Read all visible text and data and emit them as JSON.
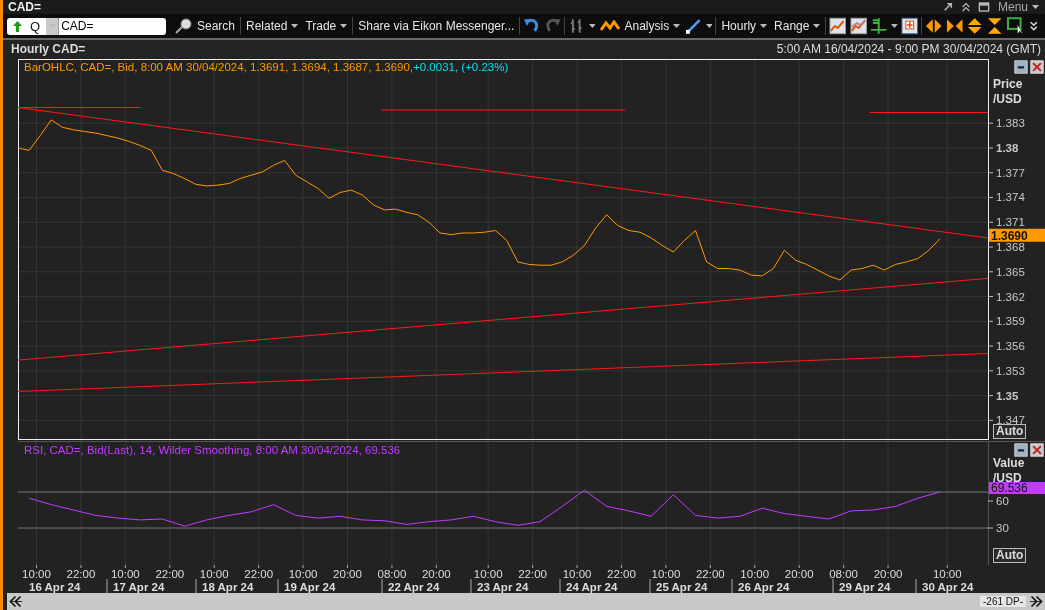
{
  "window": {
    "title": "CAD="
  },
  "title_bar": {
    "menu": "Menu"
  },
  "toolbar": {
    "quote_type": "Q",
    "symbol_field": {
      "value": "CAD="
    },
    "search": "Search",
    "related": "Related",
    "trade": "Trade",
    "share": "Share via Eikon Messenger...",
    "analysis": "Analysis",
    "interval": "Hourly",
    "range": "Range"
  },
  "header": {
    "title": "Hourly CAD=",
    "date_range": "5:00 AM 16/04/2024 - 9:00 PM 30/04/2024 (GMT)"
  },
  "price_panel": {
    "legend": "BarOHLC, CAD=, Bid, 8:00 AM 30/04/2024, 1.3691, 1.3694, 1.3687, 1.3690, ",
    "change": "+0.0031, (+0.23%)",
    "axis_title": "Price /USD",
    "last_value": "1.3690",
    "auto_button": "Auto",
    "chart_data": {
      "type": "line",
      "ylim": [
        1.3445,
        1.3909
      ],
      "grid": true,
      "categories": [
        null,
        null,
        null,
        null,
        null,
        null,
        null,
        null,
        null,
        null,
        null,
        null,
        null,
        null,
        null,
        null,
        null,
        null,
        null,
        null,
        null,
        null,
        null,
        null,
        null,
        null,
        null,
        null,
        null,
        null,
        null,
        null,
        null,
        null,
        null,
        null,
        null,
        null,
        null,
        null,
        null,
        null,
        null,
        null,
        null,
        null,
        null,
        null,
        null,
        null,
        null,
        null,
        null,
        null,
        null,
        null,
        null,
        null,
        null,
        null,
        null,
        null,
        null,
        null,
        null,
        null,
        null,
        null,
        null,
        null,
        null,
        null,
        null,
        null,
        null,
        null,
        null,
        null,
        null,
        null,
        null,
        null,
        null,
        null
      ],
      "series": [
        {
          "color": "#ff9900",
          "values": [
            1.38,
            1.3797,
            1.3815,
            1.3834,
            1.3825,
            1.3822,
            1.382,
            1.3818,
            1.3815,
            1.3812,
            1.3808,
            1.3803,
            1.3797,
            1.3773,
            1.3769,
            1.3763,
            1.3756,
            1.3754,
            1.3755,
            1.3757,
            1.3763,
            1.3767,
            1.3771,
            1.3779,
            1.3785,
            1.3767,
            1.3759,
            1.3751,
            1.3739,
            1.3746,
            1.3749,
            1.3743,
            1.3731,
            1.3725,
            1.3726,
            1.3722,
            1.3719,
            1.371,
            1.3697,
            1.3695,
            1.3697,
            1.3697,
            1.3698,
            1.37,
            1.3688,
            1.3662,
            1.3659,
            1.3658,
            1.3658,
            1.3662,
            1.367,
            1.3682,
            1.3703,
            1.3719,
            1.3706,
            1.37,
            1.3698,
            1.3691,
            1.3682,
            1.3674,
            1.3688,
            1.37,
            1.3662,
            1.3654,
            1.3654,
            1.3652,
            1.3646,
            1.3645,
            1.3654,
            1.3676,
            1.3664,
            1.3659,
            1.3652,
            1.3645,
            1.364,
            1.3652,
            1.3654,
            1.3658,
            1.3652,
            1.3659,
            1.3662,
            1.3666,
            1.3676,
            1.369
          ]
        }
      ],
      "yticks": [
        {
          "value": 1.383,
          "label": "1.383"
        },
        {
          "value": 1.38,
          "label": "1.38"
        },
        {
          "value": 1.377,
          "label": "1.377"
        },
        {
          "value": 1.374,
          "label": "1.374"
        },
        {
          "value": 1.371,
          "label": "1.371"
        },
        {
          "value": 1.368,
          "label": "1.368"
        },
        {
          "value": 1.365,
          "label": "1.365"
        },
        {
          "value": 1.362,
          "label": "1.362"
        },
        {
          "value": 1.359,
          "label": "1.359"
        },
        {
          "value": 1.356,
          "label": "1.356"
        },
        {
          "value": 1.353,
          "label": "1.353"
        },
        {
          "value": 1.35,
          "label": "1.35"
        },
        {
          "value": 1.347,
          "label": "1.347"
        }
      ]
    }
  },
  "rsi_panel": {
    "legend": "RSI, CAD=, Bid(Last),  14, Wilder Smoothing, 8:00 AM 30/04/2024, 69.536",
    "axis_title": "Value /USD",
    "last_value": "69.536",
    "auto_button": "Auto",
    "chart_data": {
      "type": "line",
      "ylim": [
        -11.1,
        126.7
      ],
      "categories": [
        null,
        null,
        null,
        null,
        null,
        null,
        null,
        null,
        null,
        null,
        null,
        null,
        null,
        null,
        null,
        null,
        null,
        null,
        null,
        null,
        null,
        null,
        null,
        null,
        null,
        null,
        null,
        null,
        null,
        null,
        null,
        null,
        null,
        null,
        null,
        null,
        null,
        null,
        null,
        null,
        null,
        null
      ],
      "series": [
        {
          "color": "#c23cff",
          "values": [
            63,
            56,
            50,
            44,
            41,
            39,
            40,
            32,
            39,
            44,
            48,
            56,
            44,
            41,
            43,
            39,
            38,
            34,
            37,
            39,
            43,
            37,
            33,
            37,
            54,
            72,
            54,
            49,
            43,
            67,
            44,
            41,
            43,
            52,
            46,
            43,
            40,
            49,
            50,
            54,
            63,
            70
          ]
        }
      ],
      "yticks": [
        {
          "value": 60,
          "label": "60"
        },
        {
          "value": 30,
          "label": "30"
        }
      ],
      "ref_lines": [
        {
          "axis": "y",
          "value": 70
        },
        {
          "axis": "y",
          "value": 30
        }
      ]
    }
  },
  "time_axis": {
    "times": [
      "10:00",
      "22:00",
      "10:00",
      "22:00",
      "10:00",
      "22:00",
      "10:00",
      "20:00",
      "08:00",
      "20:00",
      "10:00",
      "22:00",
      "10:00",
      "22:00",
      "10:00",
      "22:00",
      "10:00",
      "20:00",
      "08:00",
      "20:00",
      "10:00"
    ],
    "dates": [
      "16 Apr 24",
      "17 Apr 24",
      "18 Apr 24",
      "19 Apr 24",
      "22 Apr 24",
      "23 Apr 24",
      "24 Apr 24",
      "25 Apr 24",
      "26 Apr 24",
      "29 Apr 24",
      "30 Apr 24"
    ]
  },
  "scrollbar": {
    "label": "-261 DP-"
  }
}
